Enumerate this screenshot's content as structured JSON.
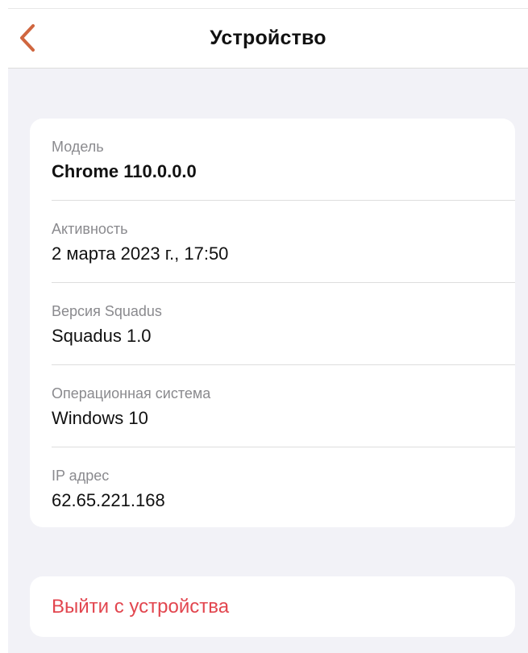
{
  "header": {
    "title": "Устройство",
    "back_icon": "chevron-left-icon",
    "accent_color": "#d0663f"
  },
  "device_info": {
    "items": [
      {
        "label": "Модель",
        "value": "Chrome 110.0.0.0"
      },
      {
        "label": "Активность",
        "value": "2 марта 2023 г., 17:50"
      },
      {
        "label": "Версия Squadus",
        "value": "Squadus 1.0"
      },
      {
        "label": "Операционная система",
        "value": "Windows 10"
      },
      {
        "label": "IP адрес",
        "value": "62.65.221.168"
      }
    ]
  },
  "actions": {
    "logout_label": "Выйти с устройства",
    "logout_color": "#e2464f"
  }
}
